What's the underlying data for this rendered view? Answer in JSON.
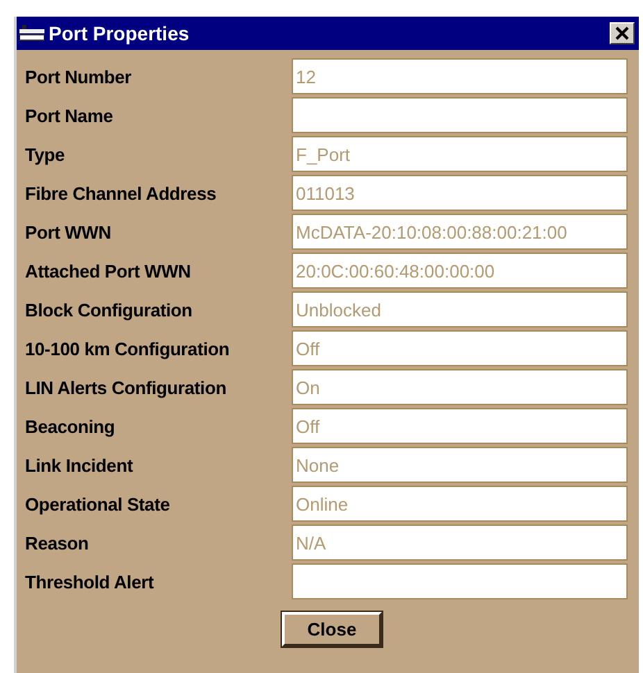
{
  "window": {
    "title": "Port Properties"
  },
  "fields": [
    {
      "label": "Port Number",
      "value": "12"
    },
    {
      "label": "Port Name"
    },
    {
      "label": "Type",
      "value": "F_Port"
    },
    {
      "label": "Fibre Channel Address",
      "value": "011013"
    },
    {
      "label": "Port WWN",
      "value": "McDATA-20:10:08:00:88:00:21:00"
    },
    {
      "label": "Attached Port WWN",
      "value": "20:0C:00:60:48:00:00:00"
    },
    {
      "label": "Block Configuration",
      "value": "Unblocked"
    },
    {
      "label": "10-100 km Configuration",
      "value": "Off"
    },
    {
      "label": "LIN Alerts Configuration",
      "value": "On"
    },
    {
      "label": "Beaconing",
      "value": "Off"
    },
    {
      "label": "Link Incident",
      "value": "None"
    },
    {
      "label": "Operational State",
      "value": "Online"
    },
    {
      "label": "Reason",
      "value": "N/A"
    },
    {
      "label": "Threshold Alert"
    }
  ],
  "buttons": [
    "Close"
  ]
}
